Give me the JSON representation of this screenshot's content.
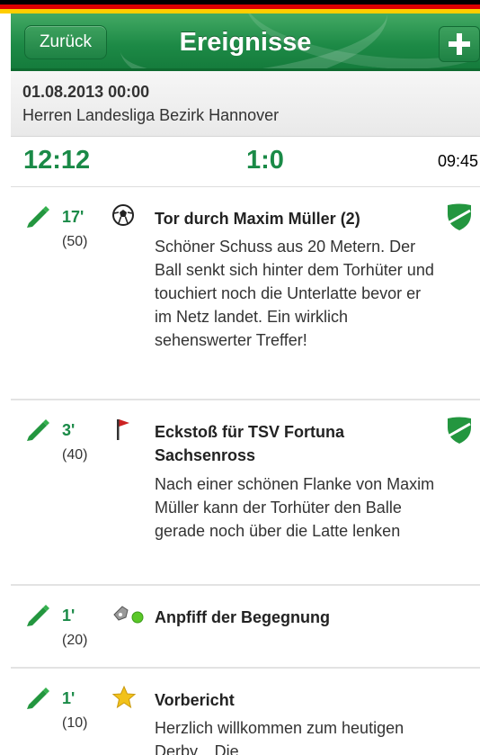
{
  "header": {
    "back_label": "Zurück",
    "title": "Ereignisse",
    "add_symbol": "+"
  },
  "match": {
    "date_time": "01.08.2013  00:00",
    "league": "Herren  Landesliga  Bezirk Hannover"
  },
  "scoreboard": {
    "time": "12:12",
    "score": "1:0",
    "clock": "09:45"
  },
  "events": [
    {
      "minute": "17'",
      "count": "(50)",
      "icon": "soccer-ball-icon",
      "title": "Tor durch Maxim Müller (2)",
      "text": "Schöner Schuss aus 20 Metern. Der Ball senkt sich hinter dem Torhüter und touchiert noch die Unterlatte bevor er im Netz landet. Ein wirklich sehenswerter Treffer!",
      "team_shield": true
    },
    {
      "minute": "3'",
      "count": "(40)",
      "icon": "corner-flag-icon",
      "title": "Eckstoß für TSV Fortuna Sachsenross",
      "text": "Nach einer schönen Flanke von Maxim Müller kann der Torhüter den Balle gerade noch über die Latte lenken",
      "team_shield": true
    },
    {
      "minute": "1'",
      "count": "(20)",
      "icon": "whistle-icon",
      "title": "Anpfiff der Begegnung",
      "text": "",
      "team_shield": false
    },
    {
      "minute": "1'",
      "count": "(10)",
      "icon": "star-icon",
      "title": "Vorbericht",
      "text": "Herzlich willkommen zum heutigen Derby... Die",
      "team_shield": false
    }
  ],
  "colors": {
    "brand_green": "#1a8a47",
    "flag_black": "#000000",
    "flag_red": "#dd0000",
    "flag_gold": "#ffce00"
  }
}
